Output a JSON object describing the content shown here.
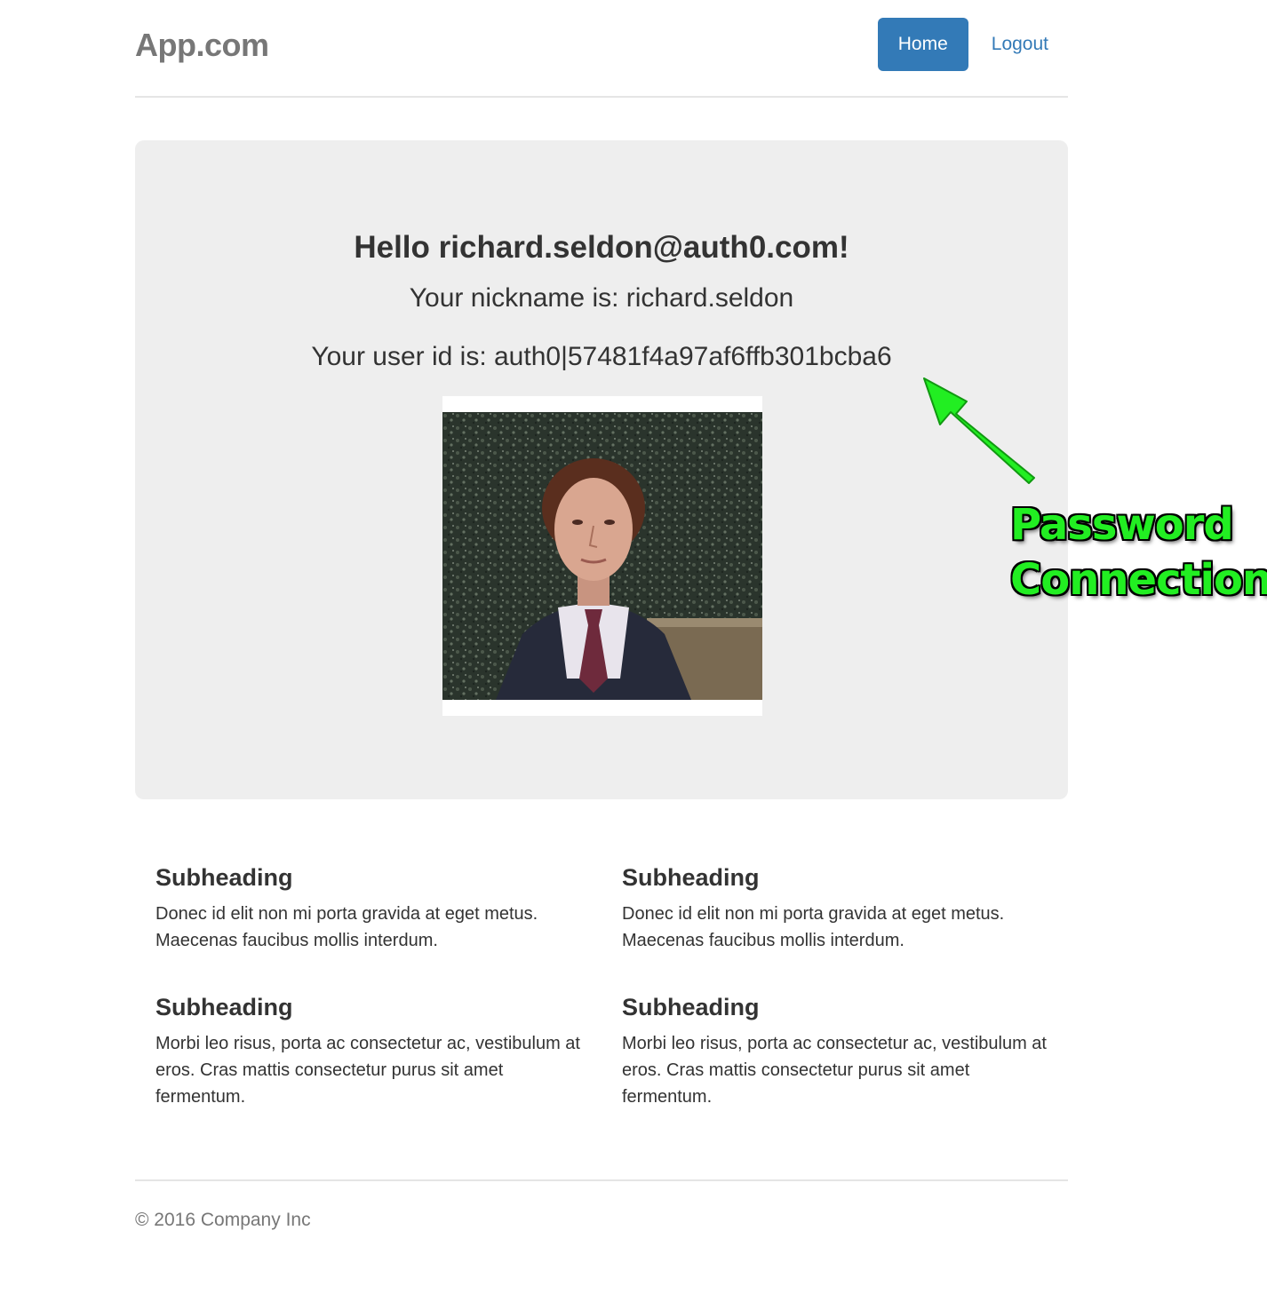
{
  "header": {
    "brand": "App.com",
    "nav": {
      "home_label": "Home",
      "logout_label": "Logout"
    }
  },
  "jumbotron": {
    "greeting": "Hello richard.seldon@auth0.com!",
    "nickname_line": "Your nickname is: richard.seldon",
    "user_id_line": "Your user id is: auth0|57481f4a97af6ffb301bcba6"
  },
  "annotation": {
    "line1": "Password",
    "line2": "Connection",
    "color": "#22ee22"
  },
  "marketing": {
    "columns": [
      {
        "blocks": [
          {
            "heading": "Subheading",
            "text": "Donec id elit non mi porta gravida at eget metus. Maecenas faucibus mollis interdum."
          },
          {
            "heading": "Subheading",
            "text": "Morbi leo risus, porta ac consectetur ac, vestibulum at eros. Cras mattis consectetur purus sit amet fermentum."
          }
        ]
      },
      {
        "blocks": [
          {
            "heading": "Subheading",
            "text": "Donec id elit non mi porta gravida at eget metus. Maecenas faucibus mollis interdum."
          },
          {
            "heading": "Subheading",
            "text": "Morbi leo risus, porta ac consectetur ac, vestibulum at eros. Cras mattis consectetur purus sit amet fermentum."
          }
        ]
      }
    ]
  },
  "footer": {
    "copyright": "© 2016 Company Inc"
  },
  "colors": {
    "primary": "#337ab7",
    "jumbotron_bg": "#eeeeee",
    "muted": "#777777"
  }
}
